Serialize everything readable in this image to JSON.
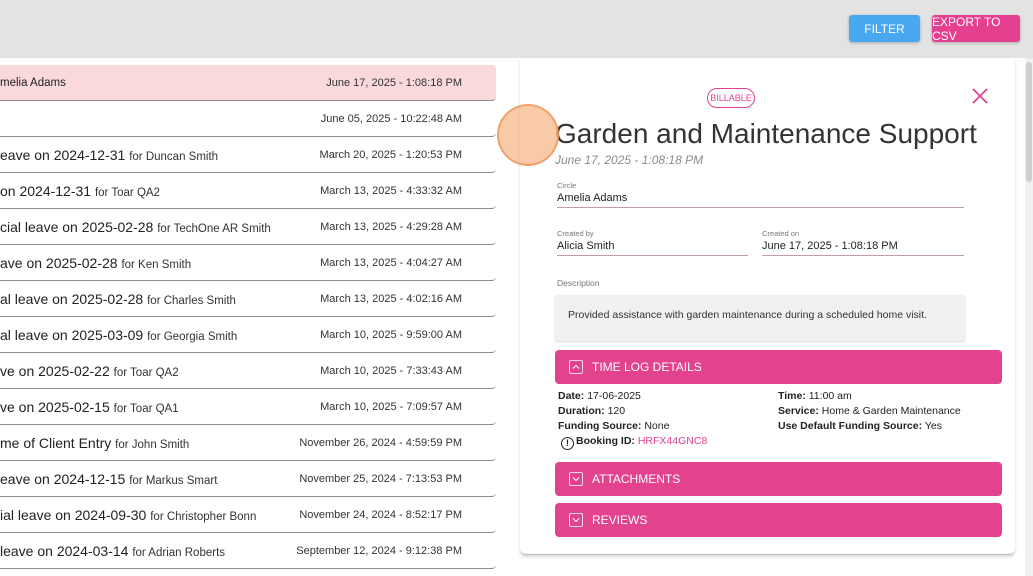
{
  "toolbar": {
    "filter_label": "FILTER",
    "export_label": "EXPORT TO CSV"
  },
  "list": {
    "rows": [
      {
        "title": "melia Adams",
        "for": "",
        "date": "June 17, 2025 - 1:08:18 PM",
        "selected": true
      },
      {
        "title": "",
        "for": "",
        "date": "June 05, 2025 - 10:22:48 AM"
      },
      {
        "title": "eave on 2024-12-31 ",
        "for": "for Duncan Smith",
        "date": "March 20, 2025 - 1:20:53 PM"
      },
      {
        "title": "on 2024-12-31 ",
        "for": "for Toar QA2",
        "date": "March 13, 2025 - 4:33:32 AM"
      },
      {
        "title": "cial leave on 2025-02-28 ",
        "for": "for TechOne AR Smith",
        "date": "March 13, 2025 - 4:29:28 AM"
      },
      {
        "title": "ave on 2025-02-28 ",
        "for": "for Ken Smith",
        "date": "March 13, 2025 - 4:04:27 AM"
      },
      {
        "title": "al leave on 2025-02-28 ",
        "for": "for Charles Smith",
        "date": "March 13, 2025 - 4:02:16 AM"
      },
      {
        "title": "al leave on 2025-03-09 ",
        "for": "for Georgia Smith",
        "date": "March 10, 2025 - 9:59:00 AM"
      },
      {
        "title": "ve on 2025-02-22 ",
        "for": "for Toar QA2",
        "date": "March 10, 2025 - 7:33:43 AM"
      },
      {
        "title": "ve on 2025-02-15 ",
        "for": "for Toar QA1",
        "date": "March 10, 2025 - 7:09:57 AM"
      },
      {
        "title": "me of Client Entry ",
        "for": "for John Smith",
        "date": "November 26, 2024 - 4:59:59 PM"
      },
      {
        "title": "eave on 2024-12-15 ",
        "for": "for Markus Smart",
        "date": "November 25, 2024 - 7:13:53 PM"
      },
      {
        "title": "ial leave on 2024-09-30 ",
        "for": "for Christopher Bonn",
        "date": "November 24, 2024 - 8:52:17 PM"
      },
      {
        "title": "leave on 2024-03-14 ",
        "for": "for Adrian Roberts",
        "date": "September 12, 2024 - 9:12:38 PM"
      }
    ]
  },
  "detail": {
    "badge": "BILLABLE",
    "title": "Garden and Maintenance Support",
    "date": "June 17, 2025 - 1:08:18 PM",
    "circle_label": "Circle",
    "circle_value": "Amelia Adams",
    "created_by_label": "Created by",
    "created_by_value": "Alicia Smith",
    "created_on_label": "Created on",
    "created_on_value": "June 17, 2025 - 1:08:18 PM",
    "description_label": "Description",
    "description_value": "Provided assistance with garden maintenance during a scheduled home visit.",
    "sections": {
      "time_log": "TIME LOG DETAILS",
      "attachments": "ATTACHMENTS",
      "reviews": "REVIEWS"
    },
    "time_log": {
      "date_label": "Date:",
      "date_value": "17-06-2025",
      "duration_label": "Duration:",
      "duration_value": "120",
      "funding_label": "Funding Source:",
      "funding_value": "None",
      "booking_label": "Booking ID:",
      "booking_value": "HRFX44GNC8",
      "time_label": "Time:",
      "time_value": "11:00 am",
      "service_label": "Service:",
      "service_value": "Home & Garden Maintenance",
      "default_funding_label": "Use Default Funding Source:",
      "default_funding_value": "Yes"
    }
  },
  "colors": {
    "accent": "#e3428e",
    "filter": "#4aa8f0",
    "selected_row": "#f9d9dc"
  },
  "icons": {
    "close": "close-icon",
    "expand_up": "chevron-up-icon",
    "expand_down": "chevron-down-icon",
    "alert": "exclamation-circle-icon"
  }
}
